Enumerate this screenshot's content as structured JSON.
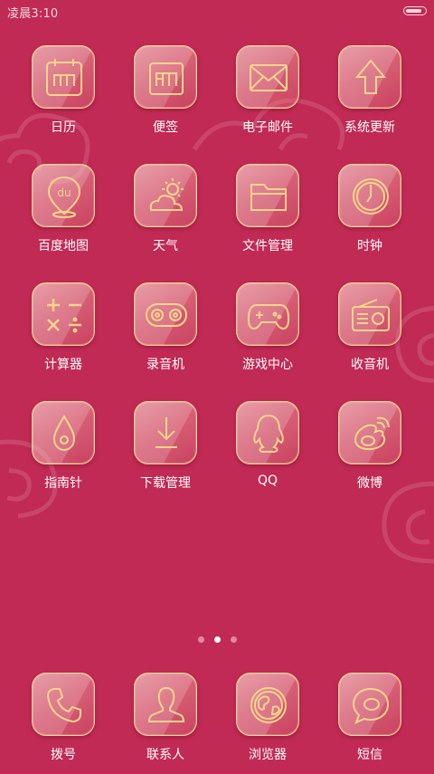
{
  "status_bar": {
    "time": "凌晨3:10"
  },
  "apps": [
    {
      "label": "日历",
      "icon": "calendar-icon"
    },
    {
      "label": "便签",
      "icon": "notes-icon"
    },
    {
      "label": "电子邮件",
      "icon": "mail-icon"
    },
    {
      "label": "系统更新",
      "icon": "update-icon"
    },
    {
      "label": "百度地图",
      "icon": "map-pin-icon"
    },
    {
      "label": "天气",
      "icon": "weather-icon"
    },
    {
      "label": "文件管理",
      "icon": "folder-icon"
    },
    {
      "label": "时钟",
      "icon": "clock-icon"
    },
    {
      "label": "计算器",
      "icon": "calculator-icon"
    },
    {
      "label": "录音机",
      "icon": "recorder-icon"
    },
    {
      "label": "游戏中心",
      "icon": "gamepad-icon"
    },
    {
      "label": "收音机",
      "icon": "radio-icon"
    },
    {
      "label": "指南针",
      "icon": "compass-icon"
    },
    {
      "label": "下载管理",
      "icon": "download-icon"
    },
    {
      "label": "QQ",
      "icon": "qq-icon"
    },
    {
      "label": "微博",
      "icon": "weibo-icon"
    }
  ],
  "page_indicator": {
    "count": 3,
    "active": 2
  },
  "dock": [
    {
      "label": "拨号",
      "icon": "phone-icon"
    },
    {
      "label": "联系人",
      "icon": "contacts-icon"
    },
    {
      "label": "浏览器",
      "icon": "browser-icon"
    },
    {
      "label": "短信",
      "icon": "message-icon"
    }
  ],
  "colors": {
    "background": "#c12a55",
    "icon_line": "#f6d48a",
    "label": "#ffffff"
  },
  "battery_level": 0.9
}
